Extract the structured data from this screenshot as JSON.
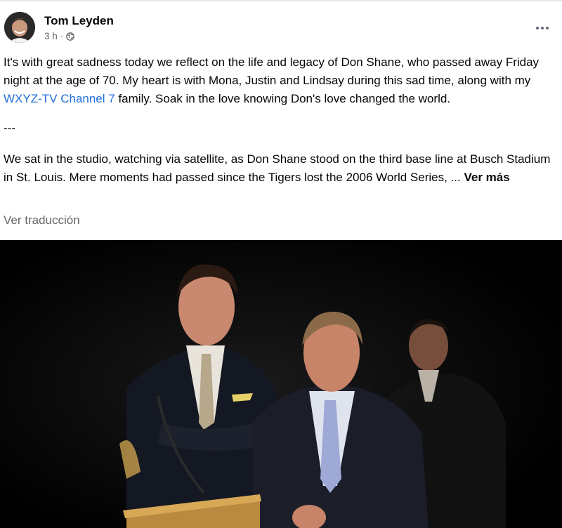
{
  "post": {
    "author": "Tom Leyden",
    "time": "3 h",
    "separator": "·",
    "privacy_icon": "globe-icon",
    "more_icon": "more-options-icon",
    "paragraph1_before_link": "It's with great sadness today we reflect on the life and legacy of Don Shane, who passed away Friday night at the age of 70. My heart is with Mona, Justin and Lindsay during this sad time, along with my ",
    "paragraph1_link": "WXYZ-TV Channel 7",
    "paragraph1_after_link": " family. Soak in the love knowing Don's love changed the world.",
    "divider": "---",
    "paragraph2": "We sat in the studio, watching via satellite, as Don Shane stood on the third base line at Busch Stadium in St. Louis. Mere moments had passed since the Tigers lost the 2006 World Series, ... ",
    "see_more": "Ver más",
    "translate": "Ver traducción"
  },
  "colors": {
    "link": "#216fdb",
    "meta": "#65676b",
    "text": "#050505"
  }
}
